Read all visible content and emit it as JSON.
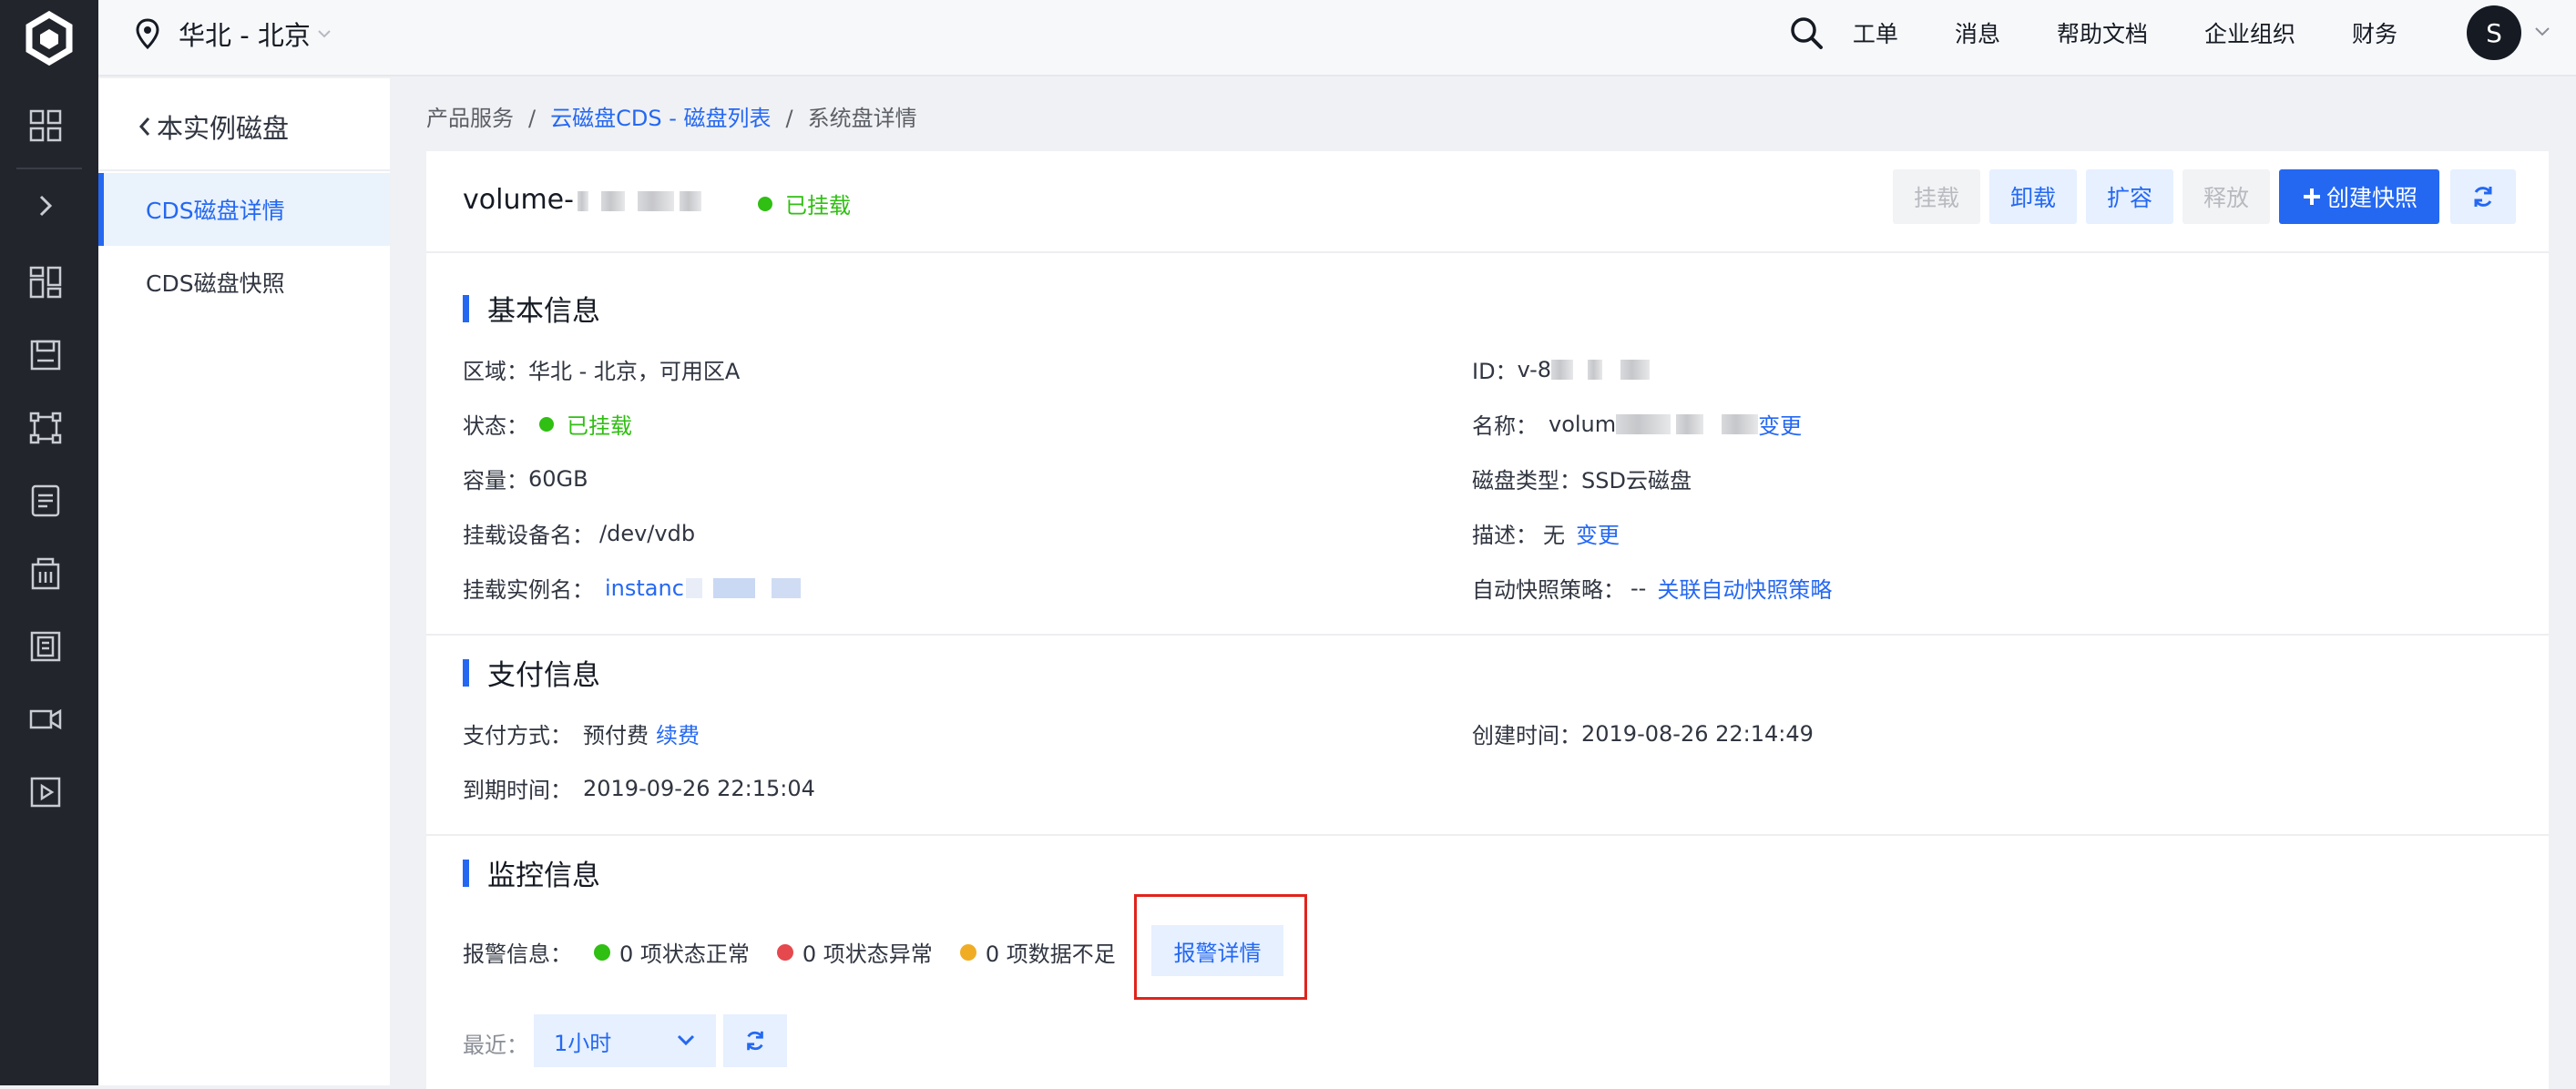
{
  "topbar": {
    "region": "华北 - 北京",
    "nav": [
      "工单",
      "消息",
      "帮助文档",
      "企业组织",
      "财务"
    ],
    "avatar_letter": "S"
  },
  "sidebar": {
    "back_label": "本实例磁盘",
    "items": [
      {
        "label": "CDS磁盘详情",
        "active": true
      },
      {
        "label": "CDS磁盘快照",
        "active": false
      }
    ]
  },
  "breadcrumb": {
    "root": "产品服务",
    "middle": "云磁盘CDS - 磁盘列表",
    "current": "系统盘详情"
  },
  "header": {
    "volume_name_prefix": "volume-",
    "status": "已挂载",
    "buttons": {
      "attach": "挂载",
      "detach": "卸载",
      "resize": "扩容",
      "release": "释放",
      "create_snapshot": "创建快照"
    }
  },
  "basic_info": {
    "title": "基本信息",
    "region_label": "区域：",
    "region_value": "华北 - 北京，可用区A",
    "status_label": "状态：",
    "status_value": "已挂载",
    "capacity_label": "容量：",
    "capacity_value": "60GB",
    "device_label": "挂载设备名：",
    "device_value": "/dev/vdb",
    "instance_label": "挂载实例名：",
    "instance_value_prefix": "instanc",
    "id_label": "ID：",
    "id_value_prefix": "v-8",
    "name_label": "名称：",
    "name_value_prefix": "volum",
    "name_change": "变更",
    "type_label": "磁盘类型：",
    "type_value": "SSD云磁盘",
    "desc_label": "描述：",
    "desc_value": "无",
    "desc_change": "变更",
    "snapshot_policy_label": "自动快照策略：",
    "snapshot_policy_value": "--",
    "snapshot_policy_link": "关联自动快照策略"
  },
  "payment_info": {
    "title": "支付信息",
    "method_label": "支付方式：",
    "method_value": "预付费",
    "renew": "续费",
    "created_label": "创建时间：",
    "created_value": "2019-08-26 22:14:49",
    "expire_label": "到期时间：",
    "expire_value": "2019-09-26 22:15:04"
  },
  "monitor_info": {
    "title": "监控信息",
    "alert_label": "报警信息：",
    "normal": "0 项状态正常",
    "abnormal": "0 项状态异常",
    "insufficient": "0 项数据不足",
    "alert_detail": "报警详情",
    "recent_label": "最近：",
    "recent_value": "1小时"
  },
  "colors": {
    "accent": "#2468f2",
    "success": "#30bf13",
    "danger": "#e5484d",
    "warning": "#f0ad24",
    "highlight_border": "#e0241b"
  },
  "icons": [
    "logo-icon",
    "grid-icon",
    "chevron-right-icon",
    "dashboard-icon",
    "save-icon",
    "network-icon",
    "list-icon",
    "building-icon",
    "frame-icon",
    "camera-icon",
    "play-icon",
    "location-pin-icon",
    "search-icon",
    "refresh-icon",
    "plus-icon",
    "chevron-down-icon",
    "chevron-left-icon"
  ]
}
